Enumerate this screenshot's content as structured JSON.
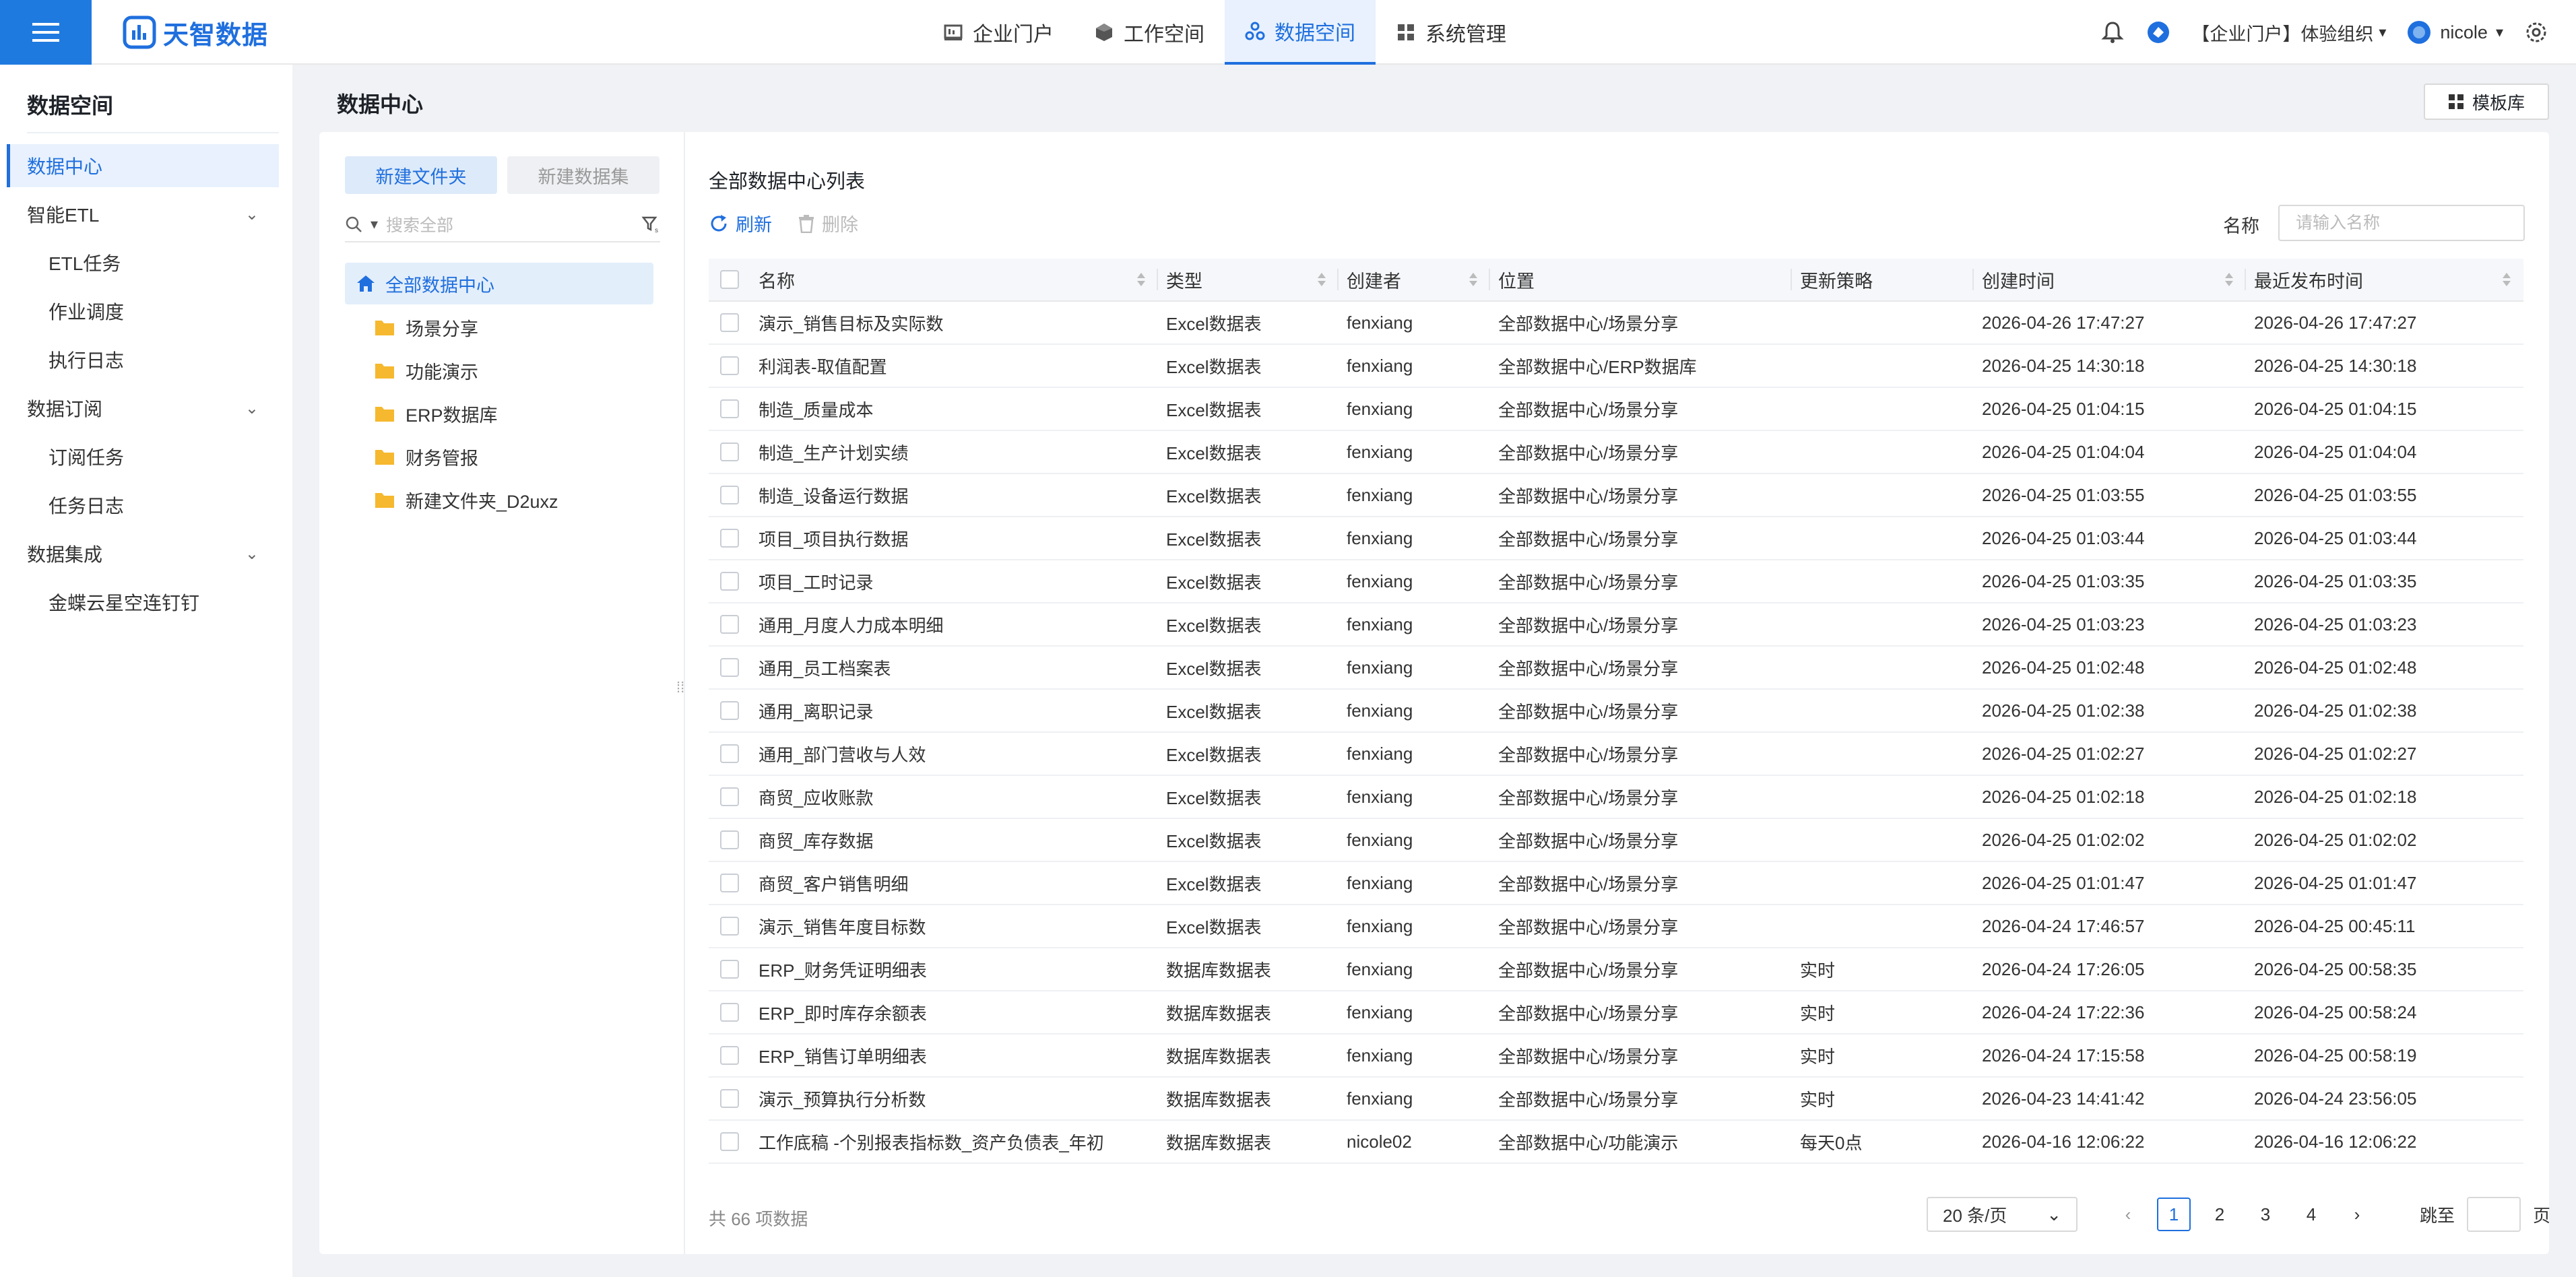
{
  "brand": {
    "name": "天智数据",
    "accent": "#1f6fde"
  },
  "topnav": {
    "items": [
      {
        "label": "企业门户",
        "icon": "portal-icon"
      },
      {
        "label": "工作空间",
        "icon": "cube-icon"
      },
      {
        "label": "数据空间",
        "icon": "data-space-icon",
        "active": true
      },
      {
        "label": "系统管理",
        "icon": "grid-icon"
      }
    ],
    "org": "【企业门户】体验组织",
    "user": "nicole"
  },
  "sidebar": {
    "title": "数据空间",
    "items": [
      {
        "label": "数据中心",
        "active": true
      },
      {
        "label": "智能ETL",
        "group": true
      },
      {
        "label": "ETL任务"
      },
      {
        "label": "作业调度"
      },
      {
        "label": "执行日志"
      },
      {
        "label": "数据订阅",
        "group": true
      },
      {
        "label": "订阅任务"
      },
      {
        "label": "任务日志"
      },
      {
        "label": "数据集成",
        "group": true
      },
      {
        "label": "金蝶云星空连钉钉"
      }
    ]
  },
  "main": {
    "title": "数据中心",
    "template_button": "模板库"
  },
  "tree": {
    "new_folder": "新建文件夹",
    "new_dataset": "新建数据集",
    "search_placeholder": "搜索全部",
    "root": "全部数据中心",
    "folders": [
      "场景分享",
      "功能演示",
      "ERP数据库",
      "财务管报",
      "新建文件夹_D2uxz"
    ]
  },
  "list": {
    "title": "全部数据中心列表",
    "refresh": "刷新",
    "delete": "删除",
    "name_label": "名称",
    "name_placeholder": "请输入名称",
    "columns": [
      "名称",
      "类型",
      "创建者",
      "位置",
      "更新策略",
      "创建时间",
      "最近发布时间"
    ],
    "rows": [
      [
        "演示_销售目标及实际数",
        "Excel数据表",
        "fenxiang",
        "全部数据中心/场景分享",
        "",
        "2026-04-26 17:47:27",
        "2026-04-26 17:47:27"
      ],
      [
        "利润表-取值配置",
        "Excel数据表",
        "fenxiang",
        "全部数据中心/ERP数据库",
        "",
        "2026-04-25 14:30:18",
        "2026-04-25 14:30:18"
      ],
      [
        "制造_质量成本",
        "Excel数据表",
        "fenxiang",
        "全部数据中心/场景分享",
        "",
        "2026-04-25 01:04:15",
        "2026-04-25 01:04:15"
      ],
      [
        "制造_生产计划实绩",
        "Excel数据表",
        "fenxiang",
        "全部数据中心/场景分享",
        "",
        "2026-04-25 01:04:04",
        "2026-04-25 01:04:04"
      ],
      [
        "制造_设备运行数据",
        "Excel数据表",
        "fenxiang",
        "全部数据中心/场景分享",
        "",
        "2026-04-25 01:03:55",
        "2026-04-25 01:03:55"
      ],
      [
        "项目_项目执行数据",
        "Excel数据表",
        "fenxiang",
        "全部数据中心/场景分享",
        "",
        "2026-04-25 01:03:44",
        "2026-04-25 01:03:44"
      ],
      [
        "项目_工时记录",
        "Excel数据表",
        "fenxiang",
        "全部数据中心/场景分享",
        "",
        "2026-04-25 01:03:35",
        "2026-04-25 01:03:35"
      ],
      [
        "通用_月度人力成本明细",
        "Excel数据表",
        "fenxiang",
        "全部数据中心/场景分享",
        "",
        "2026-04-25 01:03:23",
        "2026-04-25 01:03:23"
      ],
      [
        "通用_员工档案表",
        "Excel数据表",
        "fenxiang",
        "全部数据中心/场景分享",
        "",
        "2026-04-25 01:02:48",
        "2026-04-25 01:02:48"
      ],
      [
        "通用_离职记录",
        "Excel数据表",
        "fenxiang",
        "全部数据中心/场景分享",
        "",
        "2026-04-25 01:02:38",
        "2026-04-25 01:02:38"
      ],
      [
        "通用_部门营收与人效",
        "Excel数据表",
        "fenxiang",
        "全部数据中心/场景分享",
        "",
        "2026-04-25 01:02:27",
        "2026-04-25 01:02:27"
      ],
      [
        "商贸_应收账款",
        "Excel数据表",
        "fenxiang",
        "全部数据中心/场景分享",
        "",
        "2026-04-25 01:02:18",
        "2026-04-25 01:02:18"
      ],
      [
        "商贸_库存数据",
        "Excel数据表",
        "fenxiang",
        "全部数据中心/场景分享",
        "",
        "2026-04-25 01:02:02",
        "2026-04-25 01:02:02"
      ],
      [
        "商贸_客户销售明细",
        "Excel数据表",
        "fenxiang",
        "全部数据中心/场景分享",
        "",
        "2026-04-25 01:01:47",
        "2026-04-25 01:01:47"
      ],
      [
        "演示_销售年度目标数",
        "Excel数据表",
        "fenxiang",
        "全部数据中心/场景分享",
        "",
        "2026-04-24 17:46:57",
        "2026-04-25 00:45:11"
      ],
      [
        "ERP_财务凭证明细表",
        "数据库数据表",
        "fenxiang",
        "全部数据中心/场景分享",
        "实时",
        "2026-04-24 17:26:05",
        "2026-04-25 00:58:35"
      ],
      [
        "ERP_即时库存余额表",
        "数据库数据表",
        "fenxiang",
        "全部数据中心/场景分享",
        "实时",
        "2026-04-24 17:22:36",
        "2026-04-25 00:58:24"
      ],
      [
        "ERP_销售订单明细表",
        "数据库数据表",
        "fenxiang",
        "全部数据中心/场景分享",
        "实时",
        "2026-04-24 17:15:58",
        "2026-04-25 00:58:19"
      ],
      [
        "演示_预算执行分析数",
        "数据库数据表",
        "fenxiang",
        "全部数据中心/场景分享",
        "实时",
        "2026-04-23 14:41:42",
        "2026-04-24 23:56:05"
      ],
      [
        "工作底稿 -个别报表指标数_资产负债表_年初",
        "数据库数据表",
        "nicole02",
        "全部数据中心/功能演示",
        "每天0点",
        "2026-04-16 12:06:22",
        "2026-04-16 12:06:22"
      ]
    ],
    "total": "共 66 项数据",
    "page_size": "20 条/页",
    "pages": [
      "1",
      "2",
      "3",
      "4"
    ],
    "current_page": "1",
    "jump_label": "跳至",
    "page_unit": "页"
  }
}
